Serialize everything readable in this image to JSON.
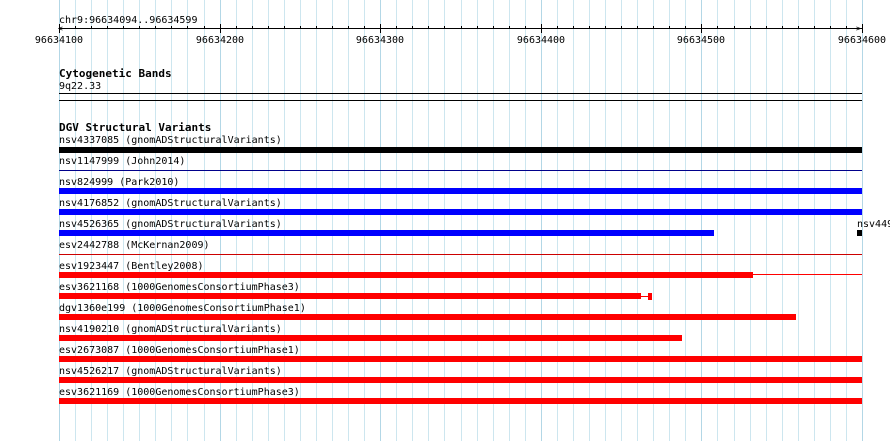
{
  "ruler": {
    "location": "chr9:96634094..96634599",
    "ticks": [
      "96634100",
      "96634200",
      "96634300",
      "96634400",
      "96634500",
      "96634600"
    ]
  },
  "cytoband": {
    "title": "Cytogenetic Bands",
    "band": "9q22.33"
  },
  "dgv": {
    "title": "DGV Structural Variants",
    "features": [
      {
        "label": "nsv4337085 (gnomADStructuralVariants)",
        "color": "#000000"
      },
      {
        "label": "nsv1147999 (John2014)",
        "color": "#00008b"
      },
      {
        "label": "nsv824999 (Park2010)",
        "color": "#0000ff"
      },
      {
        "label": "nsv4176852 (gnomADStructuralVariants)",
        "color": "#0000ff"
      },
      {
        "label": "nsv4526365 (gnomADStructuralVariants)",
        "color": "#0000ff"
      },
      {
        "label": "esv2442788 (McKernan2009)",
        "color": "#cc0000"
      },
      {
        "label": "esv1923447 (Bentley2008)",
        "color": "#ff0000"
      },
      {
        "label": "esv3621168 (1000GenomesConsortiumPhase3)",
        "color": "#ff0000"
      },
      {
        "label": "dgv1360e199 (1000GenomesConsortiumPhase1)",
        "color": "#ff0000"
      },
      {
        "label": "nsv4190210 (gnomADStructuralVariants)",
        "color": "#ff0000"
      },
      {
        "label": "esv2673087 (1000GenomesConsortiumPhase1)",
        "color": "#ff0000"
      },
      {
        "label": "nsv4526217 (gnomADStructuralVariants)",
        "color": "#ff0000"
      },
      {
        "label": "esv3621169 (1000GenomesConsortiumPhase3)",
        "color": "#ff0000"
      }
    ],
    "edge_label": "nsv449"
  }
}
